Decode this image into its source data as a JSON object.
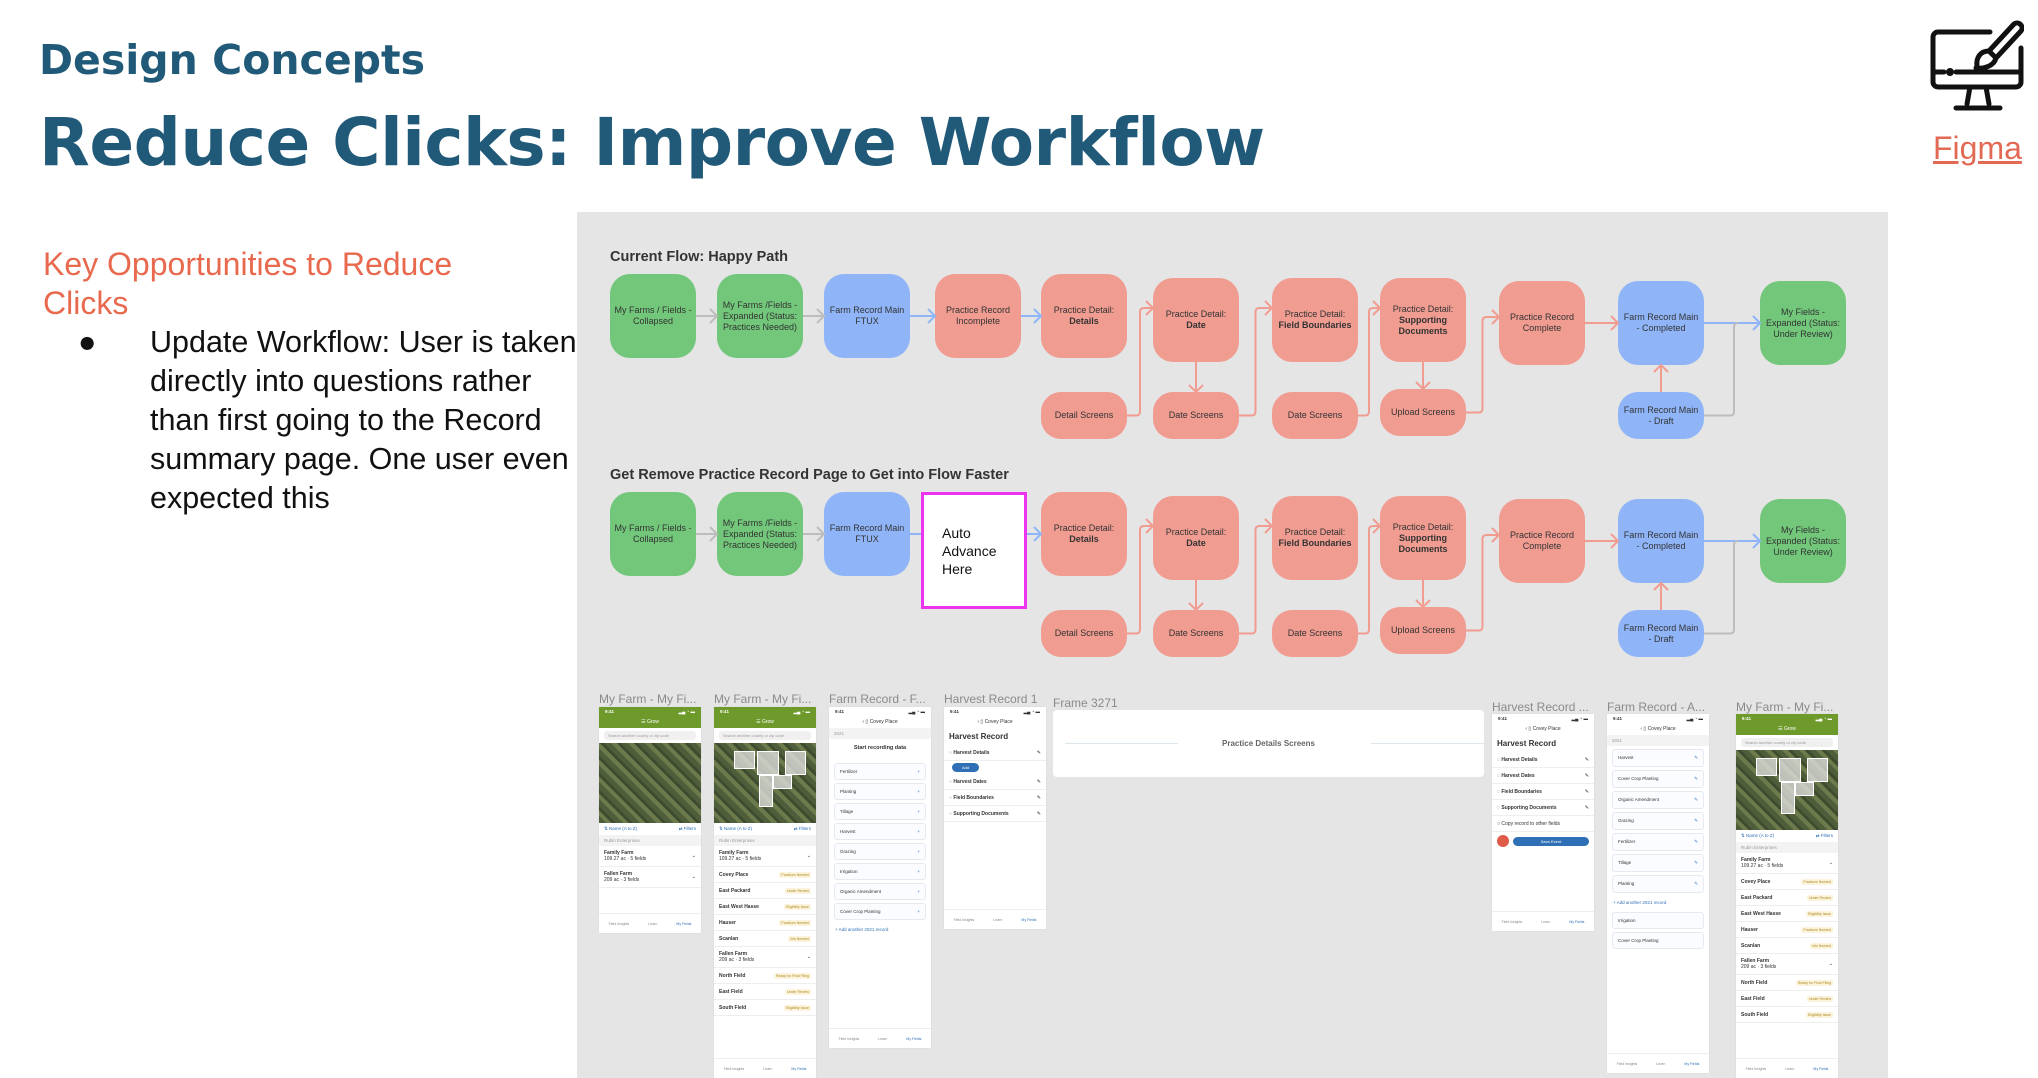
{
  "header": {
    "kicker": "Design Concepts",
    "title": "Reduce Clicks: Improve Workflow"
  },
  "figma": {
    "icon": "monitor-paintbrush-icon",
    "link_label": "Figma"
  },
  "left": {
    "heading": "Key Opportunities to Reduce Clicks",
    "bullets": [
      "Update Workflow: User is taken directly into questions rather than first going to the Record summary page. One user even expected this"
    ]
  },
  "colors": {
    "heading": "#215a79",
    "accent": "#e8694d",
    "green": "#72c77a",
    "blue": "#8fb5f8",
    "salmon": "#f19c91",
    "highlight": "#ee33ee",
    "panel": "#e5e5e5"
  },
  "flows": [
    {
      "label": "Current Flow: Happy Path",
      "nodes": {
        "b1": {
          "color": "green",
          "text": "My Farms / Fields - Collapsed"
        },
        "b2": {
          "color": "green",
          "text": "My Farms /Fields - Expanded (Status: Practices Needed)"
        },
        "b3": {
          "color": "blue",
          "text": "Farm Record Main FTUX"
        },
        "b4": {
          "color": "salmon",
          "text": "Practice Record Incomplete"
        },
        "b5": {
          "color": "salmon",
          "text": "Practice Detail:",
          "bold": "Details"
        },
        "b6": {
          "color": "salmon",
          "text": "Practice Detail:",
          "bold": "Date"
        },
        "b7": {
          "color": "salmon",
          "text": "Practice Detail:",
          "bold": "Field Boundaries"
        },
        "b8": {
          "color": "salmon",
          "text": "Practice Detail:",
          "bold": "Supporting Documents"
        },
        "b9": {
          "color": "salmon",
          "text": "Practice Record Complete"
        },
        "b10": {
          "color": "blue",
          "text": "Farm Record Main - Completed"
        },
        "b11": {
          "color": "green",
          "text": "My Fields - Expanded (Status: Under Review)"
        },
        "s1": {
          "color": "salmon",
          "text": "Detail Screens"
        },
        "s2": {
          "color": "salmon",
          "text": "Date Screens"
        },
        "s3": {
          "color": "salmon",
          "text": "Date Screens"
        },
        "s4": {
          "color": "salmon",
          "text": "Upload Screens"
        },
        "s5": {
          "color": "blue",
          "text": "Farm Record Main - Draft"
        }
      }
    },
    {
      "label": "Get Remove Practice Record Page to Get into Flow Faster",
      "nodes": {
        "b1": {
          "color": "green",
          "text": "My Farms / Fields - Collapsed"
        },
        "b2": {
          "color": "green",
          "text": "My Farms /Fields - Expanded (Status: Practices Needed)"
        },
        "b3": {
          "color": "blue",
          "text": "Farm Record Main FTUX"
        },
        "b4": {
          "color": "auto",
          "text": "Auto Advance Here"
        },
        "b5": {
          "color": "salmon",
          "text": "Practice Detail:",
          "bold": "Details"
        },
        "b6": {
          "color": "salmon",
          "text": "Practice Detail:",
          "bold": "Date"
        },
        "b7": {
          "color": "salmon",
          "text": "Practice Detail:",
          "bold": "Field Boundaries"
        },
        "b8": {
          "color": "salmon",
          "text": "Practice Detail:",
          "bold": "Supporting Documents"
        },
        "b9": {
          "color": "salmon",
          "text": "Practice Record Complete"
        },
        "b10": {
          "color": "blue",
          "text": "Farm Record Main - Completed"
        },
        "b11": {
          "color": "green",
          "text": "My Fields - Expanded (Status: Under Review)"
        },
        "s1": {
          "color": "salmon",
          "text": "Detail Screens"
        },
        "s2": {
          "color": "salmon",
          "text": "Date Screens"
        },
        "s3": {
          "color": "salmon",
          "text": "Date Screens"
        },
        "s4": {
          "color": "salmon",
          "text": "Upload Screens"
        },
        "s5": {
          "color": "blue",
          "text": "Farm Record Main - Draft"
        }
      }
    }
  ],
  "tabs": [
    "Field Insights",
    "Learn",
    "My Fields"
  ],
  "frames": [
    {
      "label": "My Farm - My Fi...",
      "type": "farms",
      "header": "Grow",
      "search": "Search another county or zip code",
      "sort": "Name (A to Z)",
      "filters": "Filters",
      "section": "Rubin Enterprises",
      "rows": [
        {
          "name": "Family Farm",
          "sub": "109.27 ac · 5 fields"
        },
        {
          "name": "Fallen Farm",
          "sub": "209 ac · 3 fields"
        }
      ]
    },
    {
      "label": "My Farm - My Fi...",
      "type": "farms",
      "header": "Grow",
      "search": "Search another county or zip code",
      "sort": "Name (A to Z)",
      "filters": "Filters",
      "section": "Rubin Enterprises",
      "rows": [
        {
          "name": "Family Farm",
          "sub": "109.27 ac · 5 fields"
        },
        {
          "name": "Covey Place",
          "badge": "Practices Needed"
        },
        {
          "name": "East Packard",
          "badge": "Under Review"
        },
        {
          "name": "East West Hasse",
          "badge": "Eligibility Issue"
        },
        {
          "name": "Hauser",
          "badge": "Practices Needed"
        },
        {
          "name": "Scanlan",
          "badge": "Info Needed"
        },
        {
          "name": "Fallen Farm",
          "sub": "209 ac · 3 fields"
        },
        {
          "name": "North Field",
          "badge": "Ready for Final Filing"
        },
        {
          "name": "East Field",
          "badge": "Under Review"
        },
        {
          "name": "South Field",
          "badge": "Eligibility Issue"
        }
      ]
    },
    {
      "label": "Farm Record - F...",
      "type": "record",
      "field": "Covey Place",
      "year": "2021",
      "empty_title": "Start recording data",
      "cards": [
        "Fertilizer",
        "Planting",
        "Tillage",
        "Harvest",
        "Grazing",
        "Irrigation",
        "Organic Amendment",
        "Cover Crop Planting"
      ],
      "link": "+ Add another 2021 record"
    },
    {
      "label": "Harvest Record 1",
      "type": "harvest",
      "field": "Covey Place",
      "title": "Harvest Record",
      "add": "Add",
      "items": [
        "Harvest Details",
        "Harvest Dates",
        "Field Boundaries",
        "Supporting Documents"
      ]
    },
    {
      "label": "Frame 3271",
      "type": "divider",
      "text": "Practice Details Screens"
    },
    {
      "label": "Harvest Record ...",
      "type": "harvest2",
      "field": "Covey Place",
      "title": "Harvest Record",
      "items": [
        "Harvest Details",
        "Harvest Dates",
        "Field Boundaries",
        "Supporting Documents"
      ],
      "copy": "Copy record to other fields",
      "save": "Save Event"
    },
    {
      "label": "Farm Record - A...",
      "type": "record2",
      "field": "Covey Place",
      "year": "2021",
      "cards": [
        "Harvest",
        "Cover Crop Planting",
        "Organic Amendment",
        "Grazing",
        "Fertilizer",
        "Tillage",
        "Planting"
      ],
      "link": "+ Add another 2021 record",
      "extra": [
        "Irrigation",
        "Cover Crop Planting"
      ]
    },
    {
      "label": "My Farm - My Fi...",
      "type": "farms",
      "header": "Grow",
      "search": "Search another county or zip code",
      "sort": "Name (A to Z)",
      "filters": "Filters",
      "section": "Rubin Enterprises",
      "rows": [
        {
          "name": "Family Farm",
          "sub": "109.27 ac · 5 fields"
        },
        {
          "name": "Covey Place",
          "badge": "Practices Needed"
        },
        {
          "name": "East Packard",
          "badge": "Under Review"
        },
        {
          "name": "East West Hasse",
          "badge": "Eligibility Issue"
        },
        {
          "name": "Hauser",
          "badge": "Practices Needed"
        },
        {
          "name": "Scanlan",
          "badge": "Info Needed"
        },
        {
          "name": "Fallen Farm",
          "sub": "209 ac · 3 fields"
        },
        {
          "name": "North Field",
          "badge": "Ready for Final Filing"
        },
        {
          "name": "East Field",
          "badge": "Under Review"
        },
        {
          "name": "South Field",
          "badge": "Eligibility Issue"
        }
      ]
    }
  ]
}
